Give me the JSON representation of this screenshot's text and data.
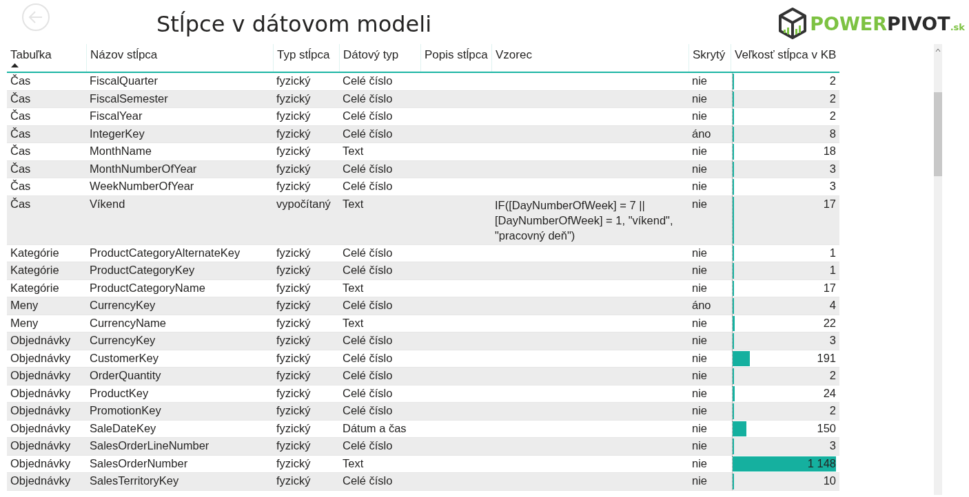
{
  "header": {
    "title": "Stĺpce v dátovom modeli",
    "logo": {
      "segments": [
        "POWER",
        "PIVOT",
        ".sk"
      ]
    }
  },
  "table": {
    "columns": [
      {
        "label": "Tabuľka",
        "sorted": true
      },
      {
        "label": "Názov stĺpca",
        "sorted": false
      },
      {
        "label": "Typ stĺpca",
        "sorted": false
      },
      {
        "label": "Dátový typ",
        "sorted": false
      },
      {
        "label": "Popis stĺpca",
        "sorted": false
      },
      {
        "label": "Vzorec",
        "sorted": false
      },
      {
        "label": "Skrytý",
        "sorted": false
      },
      {
        "label": "Veľkosť stĺpca v KB",
        "sorted": false
      }
    ],
    "rows": [
      {
        "table": "Čas",
        "column": "FiscalQuarter",
        "type": "fyzický",
        "data_type": "Celé číslo",
        "hidden": "nie",
        "size": "2",
        "level": 0.002
      },
      {
        "table": "Čas",
        "column": "FiscalSemester",
        "type": "fyzický",
        "data_type": "Celé číslo",
        "hidden": "nie",
        "size": "2",
        "level": 0.002
      },
      {
        "table": "Čas",
        "column": "FiscalYear",
        "type": "fyzický",
        "data_type": "Celé číslo",
        "hidden": "nie",
        "size": "2",
        "level": 0.002
      },
      {
        "table": "Čas",
        "column": "IntegerKey",
        "type": "fyzický",
        "data_type": "Celé číslo",
        "hidden": "áno",
        "size": "8",
        "level": 0.007
      },
      {
        "table": "Čas",
        "column": "MonthName",
        "type": "fyzický",
        "data_type": "Text",
        "hidden": "nie",
        "size": "18",
        "level": 0.016
      },
      {
        "table": "Čas",
        "column": "MonthNumberOfYear",
        "type": "fyzický",
        "data_type": "Celé číslo",
        "hidden": "nie",
        "size": "3",
        "level": 0.003
      },
      {
        "table": "Čas",
        "column": "WeekNumberOfYear",
        "type": "fyzický",
        "data_type": "Celé číslo",
        "hidden": "nie",
        "size": "3",
        "level": 0.003
      },
      {
        "table": "Čas",
        "column": "Víkend",
        "type": "vypočítaný",
        "data_type": "Text",
        "formula": "IF([DayNumberOfWeek] = 7 || [DayNumberOfWeek] = 1, \"víkend\", \"pracovný deň\")",
        "hidden": "nie",
        "size": "17",
        "level": 0.015
      },
      {
        "table": "Kategórie",
        "column": "ProductCategoryAlternateKey",
        "type": "fyzický",
        "data_type": "Celé číslo",
        "hidden": "nie",
        "size": "1",
        "level": 0.001
      },
      {
        "table": "Kategórie",
        "column": "ProductCategoryKey",
        "type": "fyzický",
        "data_type": "Celé číslo",
        "hidden": "nie",
        "size": "1",
        "level": 0.001
      },
      {
        "table": "Kategórie",
        "column": "ProductCategoryName",
        "type": "fyzický",
        "data_type": "Text",
        "hidden": "nie",
        "size": "17",
        "level": 0.015
      },
      {
        "table": "Meny",
        "column": "CurrencyKey",
        "type": "fyzický",
        "data_type": "Celé číslo",
        "hidden": "áno",
        "size": "4",
        "level": 0.003
      },
      {
        "table": "Meny",
        "column": "CurrencyName",
        "type": "fyzický",
        "data_type": "Text",
        "hidden": "nie",
        "size": "22",
        "level": 0.019
      },
      {
        "table": "Objednávky",
        "column": "CurrencyKey",
        "type": "fyzický",
        "data_type": "Celé číslo",
        "hidden": "nie",
        "size": "3",
        "level": 0.003
      },
      {
        "table": "Objednávky",
        "column": "CustomerKey",
        "type": "fyzický",
        "data_type": "Celé číslo",
        "hidden": "nie",
        "size": "191",
        "level": 0.166
      },
      {
        "table": "Objednávky",
        "column": "OrderQuantity",
        "type": "fyzický",
        "data_type": "Celé číslo",
        "hidden": "nie",
        "size": "2",
        "level": 0.002
      },
      {
        "table": "Objednávky",
        "column": "ProductKey",
        "type": "fyzický",
        "data_type": "Celé číslo",
        "hidden": "nie",
        "size": "24",
        "level": 0.021
      },
      {
        "table": "Objednávky",
        "column": "PromotionKey",
        "type": "fyzický",
        "data_type": "Celé číslo",
        "hidden": "nie",
        "size": "2",
        "level": 0.002
      },
      {
        "table": "Objednávky",
        "column": "SaleDateKey",
        "type": "fyzický",
        "data_type": "Dátum a čas",
        "hidden": "nie",
        "size": "150",
        "level": 0.131
      },
      {
        "table": "Objednávky",
        "column": "SalesOrderLineNumber",
        "type": "fyzický",
        "data_type": "Celé číslo",
        "hidden": "nie",
        "size": "3",
        "level": 0.003
      },
      {
        "table": "Objednávky",
        "column": "SalesOrderNumber",
        "type": "fyzický",
        "data_type": "Text",
        "hidden": "nie",
        "size": "1 148",
        "level": 1
      },
      {
        "table": "Objednávky",
        "column": "SalesTerritoryKey",
        "type": "fyzický",
        "data_type": "Celé číslo",
        "hidden": "nie",
        "size": "10",
        "level": 0.009
      }
    ]
  }
}
